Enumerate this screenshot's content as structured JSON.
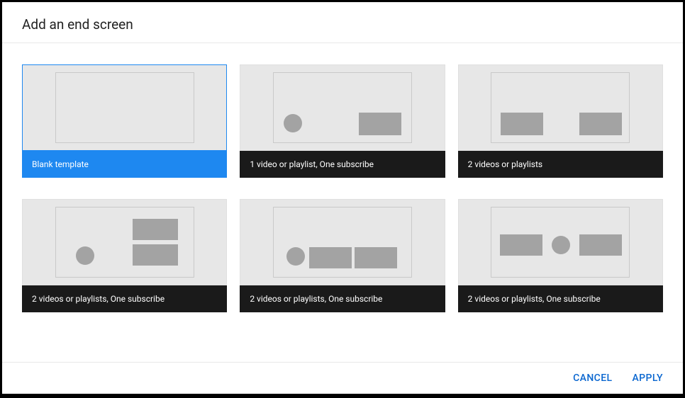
{
  "dialog": {
    "title": "Add an end screen",
    "cancel_label": "CANCEL",
    "apply_label": "APPLY"
  },
  "templates": [
    {
      "label": "Blank template",
      "selected": true
    },
    {
      "label": "1 video or playlist, One subscribe",
      "selected": false
    },
    {
      "label": "2 videos or playlists",
      "selected": false
    },
    {
      "label": "2 videos or playlists, One subscribe",
      "selected": false
    },
    {
      "label": "2 videos or playlists, One subscribe",
      "selected": false
    },
    {
      "label": "2 videos or playlists, One subscribe",
      "selected": false
    }
  ]
}
